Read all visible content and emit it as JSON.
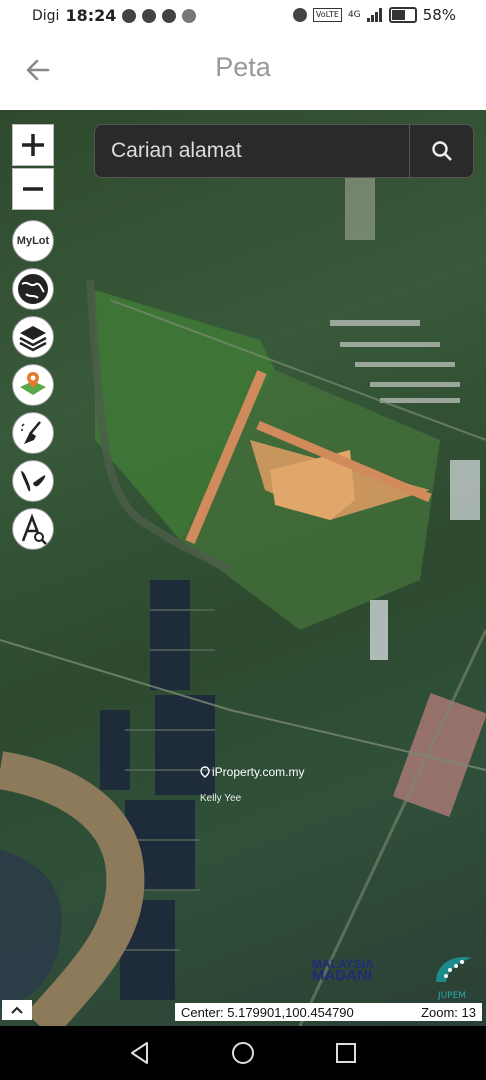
{
  "status": {
    "carrier": "Digi",
    "time": "18:24",
    "volte": "VoLTE",
    "network": "4G",
    "battery": "58%",
    "battery_level": 0.58
  },
  "appbar": {
    "title": "Peta"
  },
  "search": {
    "placeholder": "Carian alamat"
  },
  "tools": {
    "mylot": "MyLot"
  },
  "watermark": {
    "site": "iProperty.com.my",
    "agent": "Kelly Yee"
  },
  "logos": {
    "madani_1": "MALAYSIA",
    "madani_2": "MADANI",
    "jupem": "JUPEM"
  },
  "map_info": {
    "center": "Center: 5.179901,100.454790",
    "zoom": "Zoom: 13"
  }
}
